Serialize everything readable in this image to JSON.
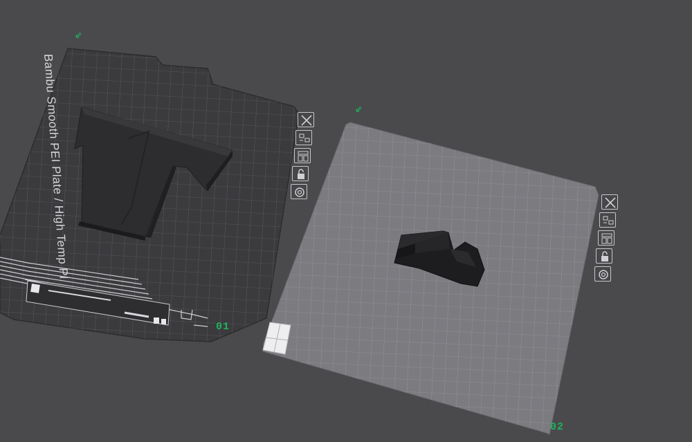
{
  "plates": [
    {
      "number": "01",
      "texture_label": "Bambu Smooth PEI Plate / High Temp Pl",
      "axis_glyph": "⇙",
      "tools": [
        {
          "name": "close-plate",
          "icon": "x-icon"
        },
        {
          "name": "arrange-plate",
          "icon": "arrange-icon"
        },
        {
          "name": "orient-plate",
          "icon": "orient-icon"
        },
        {
          "name": "lock-plate",
          "icon": "lock-icon"
        },
        {
          "name": "plate-settings",
          "icon": "gear-icon"
        }
      ]
    },
    {
      "number": "02",
      "axis_glyph": "⇙",
      "tools": [
        {
          "name": "close-plate",
          "icon": "x-icon"
        },
        {
          "name": "arrange-plate",
          "icon": "arrange-icon"
        },
        {
          "name": "orient-plate",
          "icon": "orient-icon"
        },
        {
          "name": "lock-plate",
          "icon": "lock-icon"
        },
        {
          "name": "plate-settings",
          "icon": "gear-icon"
        }
      ]
    }
  ],
  "colors": {
    "background": "#4a4a4d",
    "plate_active": "#3a3a3d",
    "plate_inactive": "#7b7b80",
    "grid_line": "#8e8e94",
    "plate_number": "#1fb35c",
    "model": "#2c2c2e"
  }
}
